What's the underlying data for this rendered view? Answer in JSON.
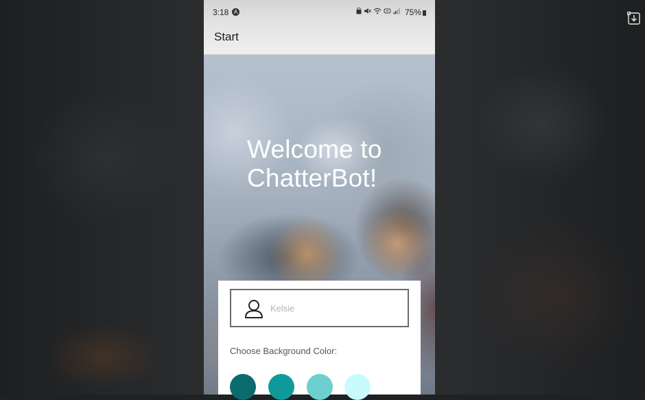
{
  "status_bar": {
    "time": "3:18",
    "alert_badge": "A",
    "battery": "75%"
  },
  "app_bar": {
    "title": "Start"
  },
  "hero": {
    "welcome_line1": "Welcome to",
    "welcome_line2": "ChatterBot!"
  },
  "form": {
    "name_value": "Kelsie",
    "color_label": "Choose Background Color:",
    "colors": [
      {
        "name": "dark-teal",
        "hex": "#0a6c6f"
      },
      {
        "name": "teal",
        "hex": "#0e9a9a"
      },
      {
        "name": "light-teal",
        "hex": "#6ecfcf"
      },
      {
        "name": "pale-cyan",
        "hex": "#c9fbfc"
      }
    ]
  },
  "icons": {
    "user": "user-icon",
    "download": "download-icon",
    "status": [
      "notification-icon",
      "mute-icon",
      "wifi-icon",
      "data-icon",
      "signal-icon",
      "battery-icon"
    ]
  }
}
